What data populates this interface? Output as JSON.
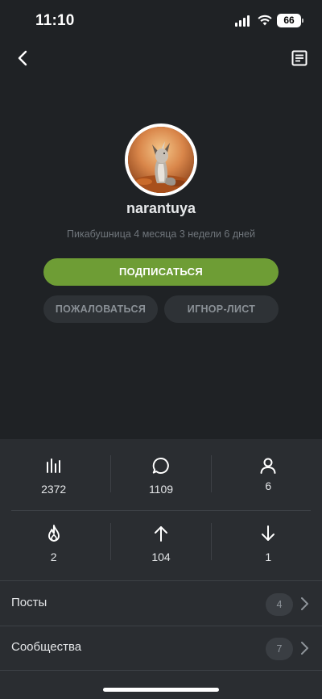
{
  "status_bar": {
    "time": "11:10",
    "battery": "66"
  },
  "nav": {
    "back_icon": "chevron-left-icon",
    "notes_icon": "notes-icon"
  },
  "profile": {
    "username": "narantuya",
    "tenure": "Пикабушница 4 месяца 3 недели 6 дней"
  },
  "actions": {
    "subscribe": "ПОДПИСАТЬСЯ",
    "report": "ПОЖАЛОВАТЬСЯ",
    "ignore": "ИГНОР-ЛИСТ"
  },
  "stats": [
    {
      "icon": "bar-chart-icon",
      "value": "2372"
    },
    {
      "icon": "comment-icon",
      "value": "1109"
    },
    {
      "icon": "user-icon",
      "value": "6"
    },
    {
      "icon": "fire-icon",
      "value": "2"
    },
    {
      "icon": "arrow-up-icon",
      "value": "104"
    },
    {
      "icon": "arrow-down-icon",
      "value": "1"
    }
  ],
  "sections": [
    {
      "label": "Посты",
      "count": "4"
    },
    {
      "label": "Сообщества",
      "count": "7"
    }
  ],
  "colors": {
    "accent": "#6e9d35",
    "background": "#1f2225",
    "panel": "#2a2d31"
  }
}
